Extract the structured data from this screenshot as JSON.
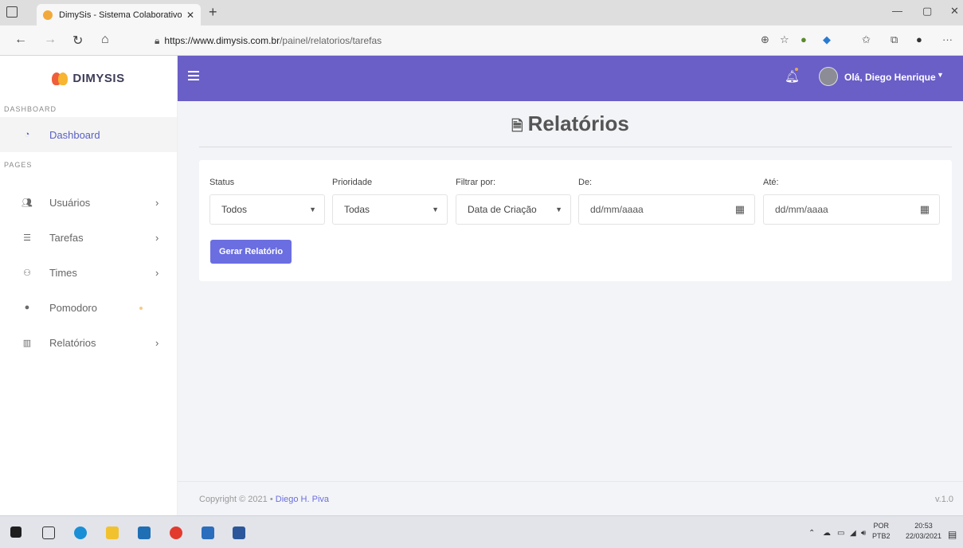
{
  "browser": {
    "tab_title": "DimySis - Sistema Colaborativo",
    "tab_close": "✕",
    "new_tab": "+",
    "url_base": "https://www.dimysis.com.br",
    "url_path": "/painel/relatorios/tarefas",
    "window_controls": [
      "—",
      "▢",
      "✕"
    ]
  },
  "sidebar": {
    "brand": "DIMYSIS",
    "section_dashboard": "DASHBOARD",
    "section_pages": "PAGES",
    "items": [
      {
        "label": "Dashboard",
        "icon": "dashboard-icon",
        "active": true
      },
      {
        "label": "Usuários",
        "icon": "users-icon",
        "has_submenu": true
      },
      {
        "label": "Tarefas",
        "icon": "tasks-icon",
        "has_submenu": true
      },
      {
        "label": "Times",
        "icon": "teams-icon",
        "has_submenu": true
      },
      {
        "label": "Pomodoro",
        "icon": "pomodoro-icon"
      },
      {
        "label": "Relatórios",
        "icon": "chart-icon",
        "has_submenu": true
      }
    ]
  },
  "topbar": {
    "greeting": "Olá, Diego Henrique",
    "accent_color": "#6a5ec7"
  },
  "main": {
    "title": "Relatórios",
    "filters": {
      "status_label": "Status",
      "status_value": "Todos",
      "priority_label": "Prioridade",
      "priority_value": "Todas",
      "filter_by_label": "Filtrar por:",
      "filter_by_value": "Data de Criação",
      "from_label": "De:",
      "from_placeholder": "dd/mm/aaaa",
      "to_label": "Até:",
      "to_placeholder": "dd/mm/aaaa"
    },
    "generate_button": "Gerar Relatório"
  },
  "footer": {
    "copyright": "Copyright © 2021 •",
    "author": "Diego H. Piva",
    "version": "v.1.0"
  },
  "taskbar": {
    "language": "POR",
    "layout": "PTB2",
    "time": "20:53",
    "date": "22/03/2021"
  }
}
